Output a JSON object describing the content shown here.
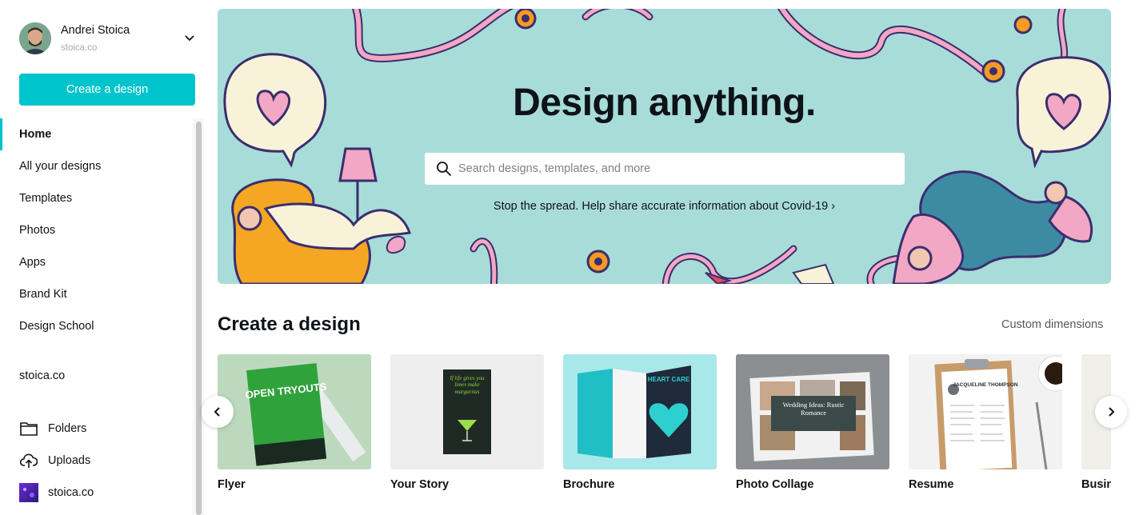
{
  "sidebar": {
    "user": {
      "name": "Andrei Stoica",
      "team": "stoica.co"
    },
    "create_label": "Create a design",
    "nav": [
      {
        "label": "Home"
      },
      {
        "label": "All your designs"
      },
      {
        "label": "Templates"
      },
      {
        "label": "Photos"
      },
      {
        "label": "Apps"
      },
      {
        "label": "Brand Kit"
      },
      {
        "label": "Design School"
      }
    ],
    "team_label": "stoica.co",
    "folders_label": "Folders",
    "uploads_label": "Uploads",
    "team_folder_label": "stoica.co"
  },
  "hero": {
    "title": "Design anything.",
    "search_placeholder": "Search designs, templates, and more",
    "covid_link": "Stop the spread. Help share accurate information about Covid-19 ›"
  },
  "create_section": {
    "title": "Create a design",
    "custom_dimensions": "Custom dimensions",
    "cards": [
      {
        "label": "Flyer",
        "thumb_text": "OPEN TRYOUTS"
      },
      {
        "label": "Your Story",
        "thumb_text": "If life gives you limes make margaritas"
      },
      {
        "label": "Brochure",
        "thumb_text": "HEART CARE"
      },
      {
        "label": "Photo Collage",
        "thumb_text": "Wedding Ideas: Rustic Romance"
      },
      {
        "label": "Resume",
        "thumb_text": "JACQUELINE THOMPSON"
      },
      {
        "label": "Busin"
      }
    ]
  },
  "colors": {
    "accent": "#00c4cc",
    "hero_bg": "#a8dcd9"
  },
  "icons": [
    "chevron-down-icon",
    "search-icon",
    "folder-icon",
    "upload-icon",
    "chevron-left-icon",
    "chevron-right-icon"
  ]
}
